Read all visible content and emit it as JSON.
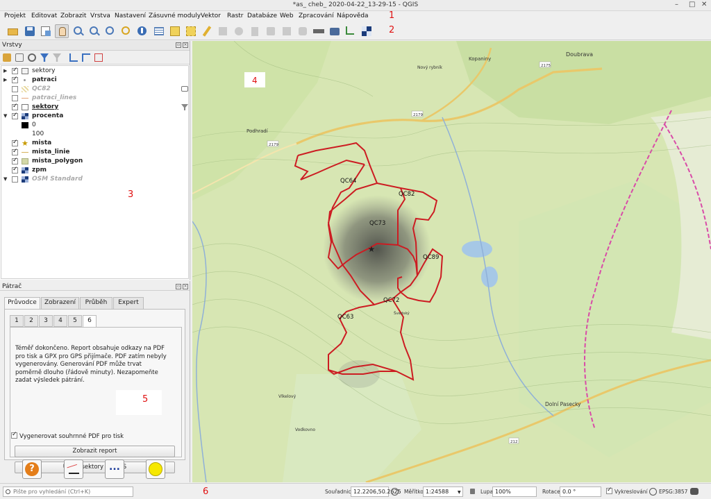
{
  "window": {
    "title": "*as_ cheb_ 2020-04-22_13-29-15 - QGIS"
  },
  "menu": [
    "Projekt",
    "Editovat",
    "Zobrazit",
    "Vrstva",
    "Nastavení",
    "Zásuvné moduly",
    "Vektor",
    "Rastr",
    "Databáze",
    "Web",
    "Zpracování",
    "Nápověda"
  ],
  "annotations": {
    "n1": "1",
    "n2": "2",
    "n3": "3",
    "n4": "4",
    "n5": "5",
    "n6": "6"
  },
  "layers_panel": {
    "title": "Vrstvy",
    "items": [
      {
        "label": "sektory",
        "style": "normal",
        "checked": true,
        "expand": "▶",
        "icon": "group-layer-icon"
      },
      {
        "label": "patraci",
        "style": "bold",
        "checked": true,
        "expand": "▶",
        "icon": "point-layer-icon"
      },
      {
        "label": "QC82",
        "style": "grey",
        "checked": false,
        "expand": "",
        "icon": "raster-layer-icon"
      },
      {
        "label": "patraci_lines",
        "style": "grey",
        "checked": false,
        "expand": "",
        "icon": "line-layer-icon"
      },
      {
        "label": "sektory",
        "style": "bold-under",
        "checked": true,
        "expand": "",
        "icon": "polygon-layer-icon"
      },
      {
        "label": "procenta",
        "style": "bold",
        "checked": true,
        "expand": "▼",
        "icon": "raster-layer-icon"
      },
      {
        "label": "0",
        "style": "legend",
        "checked": null,
        "expand": "",
        "icon": "legend-black-swatch"
      },
      {
        "label": "100",
        "style": "legend",
        "checked": null,
        "expand": "",
        "icon": ""
      },
      {
        "label": "mista",
        "style": "bold",
        "checked": true,
        "expand": "",
        "icon": "star-icon"
      },
      {
        "label": "mista_linie",
        "style": "bold",
        "checked": true,
        "expand": "",
        "icon": "line-layer-icon"
      },
      {
        "label": "mista_polygon",
        "style": "bold",
        "checked": true,
        "expand": "",
        "icon": "polygon-fill-icon"
      },
      {
        "label": "zpm",
        "style": "bold",
        "checked": true,
        "expand": "",
        "icon": "raster-layer-icon"
      },
      {
        "label": "OSM Standard",
        "style": "grey",
        "checked": false,
        "expand": "▼",
        "icon": "raster-layer-icon"
      }
    ]
  },
  "patrac": {
    "title": "Pátrač",
    "tabs": [
      "Průvodce",
      "Zobrazení",
      "Průběh",
      "Expert"
    ],
    "subtabs": [
      "1",
      "2",
      "3",
      "4",
      "5",
      "6"
    ],
    "message": "Téměř dokončeno. Report obsahuje odkazy na PDF pro tisk a GPX pro GPS přijímače. PDF zatím nebyly vygenerovány. Generování PDF může trvat poměrně dlouho (řádově minuty). Nezapomeňte zadat výsledek pátrání.",
    "checkbox_label": "Vygenerovat souhrnné PDF pro tisk",
    "btn_report": "Zobrazit report",
    "btn_gps": "Uložit sektory na GPS",
    "help_glyph": "?",
    "more_glyph": "..."
  },
  "map": {
    "sectors": [
      "QC64",
      "QC82",
      "QC73",
      "QC89",
      "QC72",
      "QC63"
    ],
    "places": [
      "Podhradí",
      "Doubrava",
      "Kopaniny",
      "Dolní Pasecky",
      "Vlkelový",
      "Vodkovno",
      "Nový rybník",
      "Švedský"
    ],
    "roads": [
      "2175",
      "2179",
      "212"
    ]
  },
  "status": {
    "search_placeholder": "Pište pro vyhledání (Ctrl+K)",
    "coord_label": "Souřadnice",
    "coord_value": "12.2206,50.2625",
    "scale_label": "Měřítko",
    "scale_value": "1:24588",
    "mag_label": "Lupa",
    "mag_value": "100%",
    "rot_label": "Rotace",
    "rot_value": "0.0 °",
    "render_label": "Vykreslování",
    "crs": "EPSG:3857"
  }
}
